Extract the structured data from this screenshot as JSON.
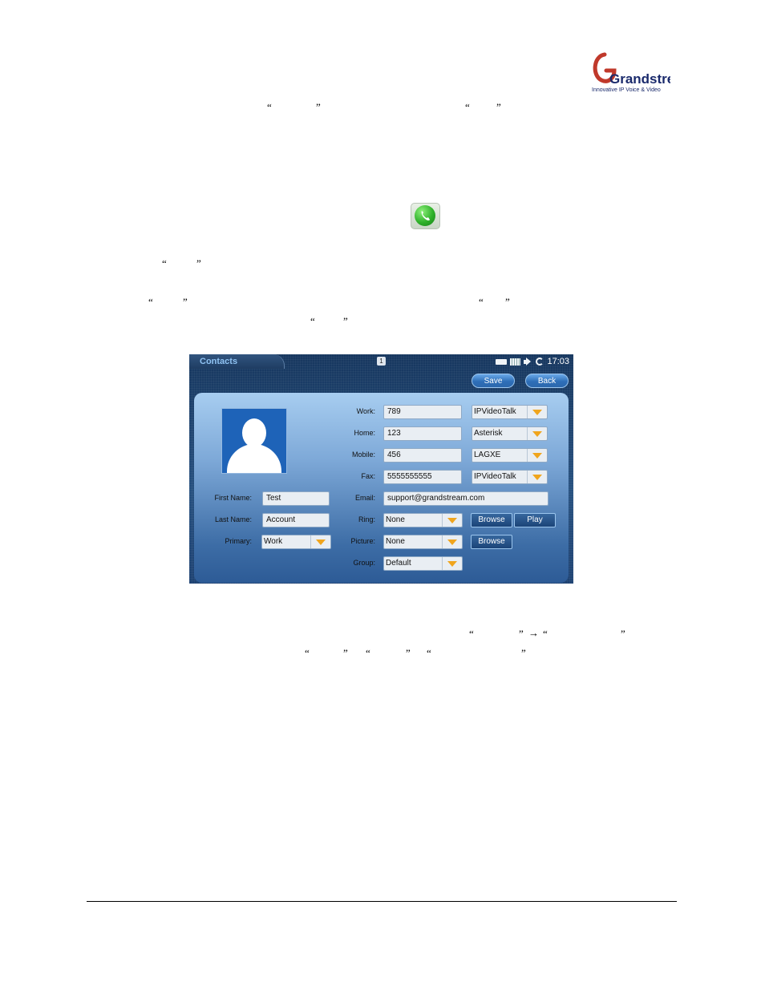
{
  "logo": {
    "text": "Grandstream",
    "tagline": "Innovative IP Voice & Video"
  },
  "doc": {
    "quote_open": "“",
    "quote_close": "”",
    "arrow": "→"
  },
  "app": {
    "title": "Contacts",
    "notification_count": "1",
    "time": "17:03",
    "buttons": {
      "save": "Save",
      "back": "Back"
    },
    "form": {
      "labels": {
        "work": "Work:",
        "home": "Home:",
        "mobile": "Mobile:",
        "fax": "Fax:",
        "email": "Email:",
        "ring": "Ring:",
        "picture": "Picture:",
        "group": "Group:",
        "first_name": "First Name:",
        "last_name": "Last Name:",
        "primary": "Primary:"
      },
      "values": {
        "work": "789",
        "home": "123",
        "mobile": "456",
        "fax": "5555555555",
        "email": "support@grandstream.com",
        "first_name": "Test",
        "last_name": "Account"
      },
      "selects": {
        "work_account": "IPVideoTalk",
        "home_account": "Asterisk",
        "mobile_account": "LAGXE",
        "fax_account": "IPVideoTalk",
        "ring": "None",
        "picture": "None",
        "group": "Default",
        "primary": "Work"
      },
      "action_buttons": {
        "ring_browse": "Browse",
        "ring_play": "Play",
        "picture_browse": "Browse"
      }
    }
  }
}
